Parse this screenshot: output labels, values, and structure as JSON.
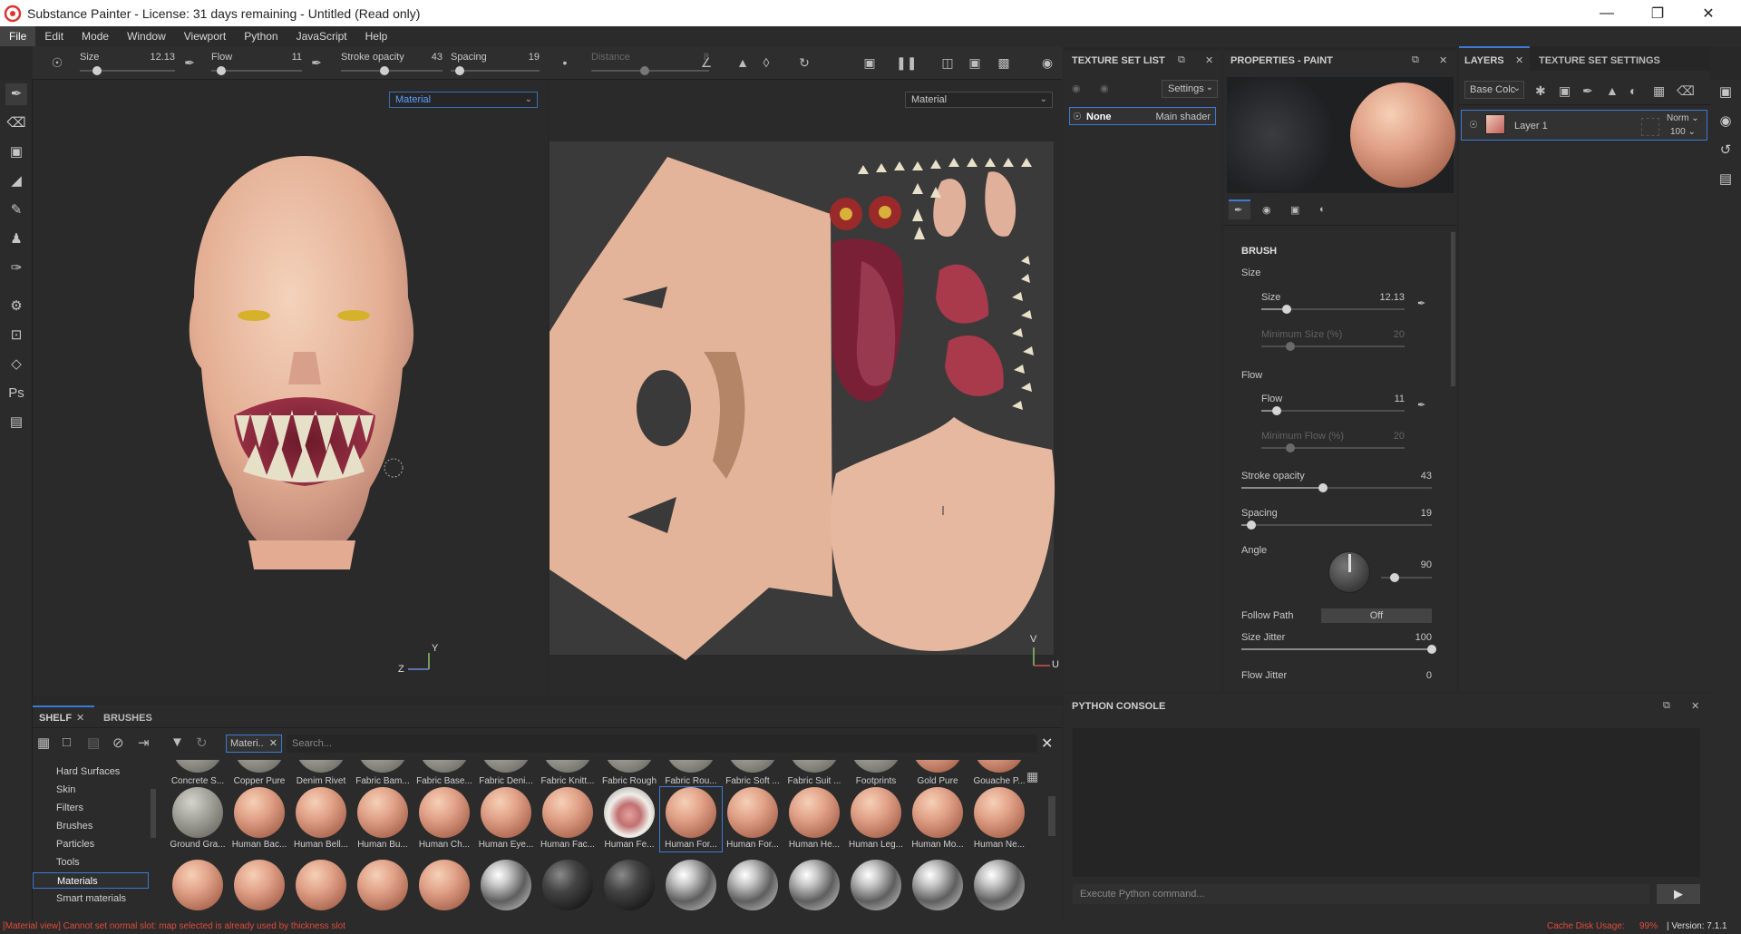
{
  "window": {
    "title": "Substance Painter - License: 31 days remaining - Untitled (Read only)"
  },
  "menu": [
    "File",
    "Edit",
    "Mode",
    "Window",
    "Viewport",
    "Python",
    "JavaScript",
    "Help"
  ],
  "toolbar": {
    "size": {
      "label": "Size",
      "value": "12.13",
      "level": 0.18
    },
    "flow": {
      "label": "Flow",
      "value": "11",
      "level": 0.11
    },
    "stroke_opacity": {
      "label": "Stroke opacity",
      "value": "43",
      "level": 0.43
    },
    "spacing": {
      "label": "Spacing",
      "value": "19",
      "level": 0.1
    },
    "distance": {
      "label": "Distance",
      "value": "8",
      "level": 0.45
    }
  },
  "viewport3d": {
    "dropdown": "Material"
  },
  "viewport2d": {
    "dropdown": "Material",
    "axis_u": "U",
    "axis_v": "V"
  },
  "axis3d": {
    "y": "Y",
    "z": "Z"
  },
  "texture_set_list": {
    "title": "TEXTURE SET LIST",
    "settings": "Settings",
    "item_name": "None",
    "item_shader": "Main shader"
  },
  "properties": {
    "title": "PROPERTIES - PAINT",
    "brush": "BRUSH",
    "size_group": "Size",
    "size": {
      "label": "Size",
      "value": "12.13",
      "level": 0.18
    },
    "min_size": {
      "label": "Minimum Size (%)",
      "value": "20",
      "level": 0.2
    },
    "flow_group": "Flow",
    "flow": {
      "label": "Flow",
      "value": "11",
      "level": 0.11
    },
    "min_flow": {
      "label": "Minimum Flow (%)",
      "value": "20",
      "level": 0.2
    },
    "stroke_opacity": {
      "label": "Stroke opacity",
      "value": "43",
      "level": 0.43
    },
    "spacing": {
      "label": "Spacing",
      "value": "19",
      "level": 0.05
    },
    "angle": {
      "label": "Angle",
      "value": "90"
    },
    "follow_path": {
      "label": "Follow Path",
      "value": "Off"
    },
    "size_jitter": {
      "label": "Size Jitter",
      "value": "100",
      "level": 1.0
    },
    "flow_jitter": {
      "label": "Flow Jitter",
      "value": "0"
    }
  },
  "layers": {
    "tab_layers": "LAYERS",
    "tab_tss": "TEXTURE SET SETTINGS",
    "channel": "Base Colc",
    "layer_name": "Layer 1",
    "blend": "Norm",
    "opacity": "100"
  },
  "python": {
    "title": "PYTHON CONSOLE",
    "placeholder": "Execute Python command..."
  },
  "shelf": {
    "tab_shelf": "SHELF",
    "tab_brushes": "BRUSHES",
    "filter_tag": "Materi..",
    "search_placeholder": "Search...",
    "categories": [
      "Hard Surfaces",
      "Skin",
      "Filters",
      "Brushes",
      "Particles",
      "Tools",
      "Materials",
      "Smart materials"
    ],
    "row0": [
      "Concrete S...",
      "Copper Pure",
      "Denim Rivet",
      "Fabric Bam...",
      "Fabric Base...",
      "Fabric Deni...",
      "Fabric Knitt...",
      "Fabric Rough",
      "Fabric Rou...",
      "Fabric Soft ...",
      "Fabric Suit ...",
      "Footprints",
      "Gold Pure",
      "Gouache P..."
    ],
    "row1": [
      "Ground Gra...",
      "Human Bac...",
      "Human Bell...",
      "Human Bu...",
      "Human Ch...",
      "Human Eye...",
      "Human Fac...",
      "Human Fe...",
      "Human For...",
      "Human For...",
      "Human He...",
      "Human Leg...",
      "Human Mo...",
      "Human Ne..."
    ]
  },
  "status": {
    "message": "[Material view] Cannot set normal slot: map selected is already used by thickness slot",
    "cache": "Cache Disk Usage:",
    "cache_value": "99%",
    "version": "| Version: 7.1.1"
  },
  "colors": {
    "accent": "#3c7ad6",
    "error": "#e04b3a"
  }
}
